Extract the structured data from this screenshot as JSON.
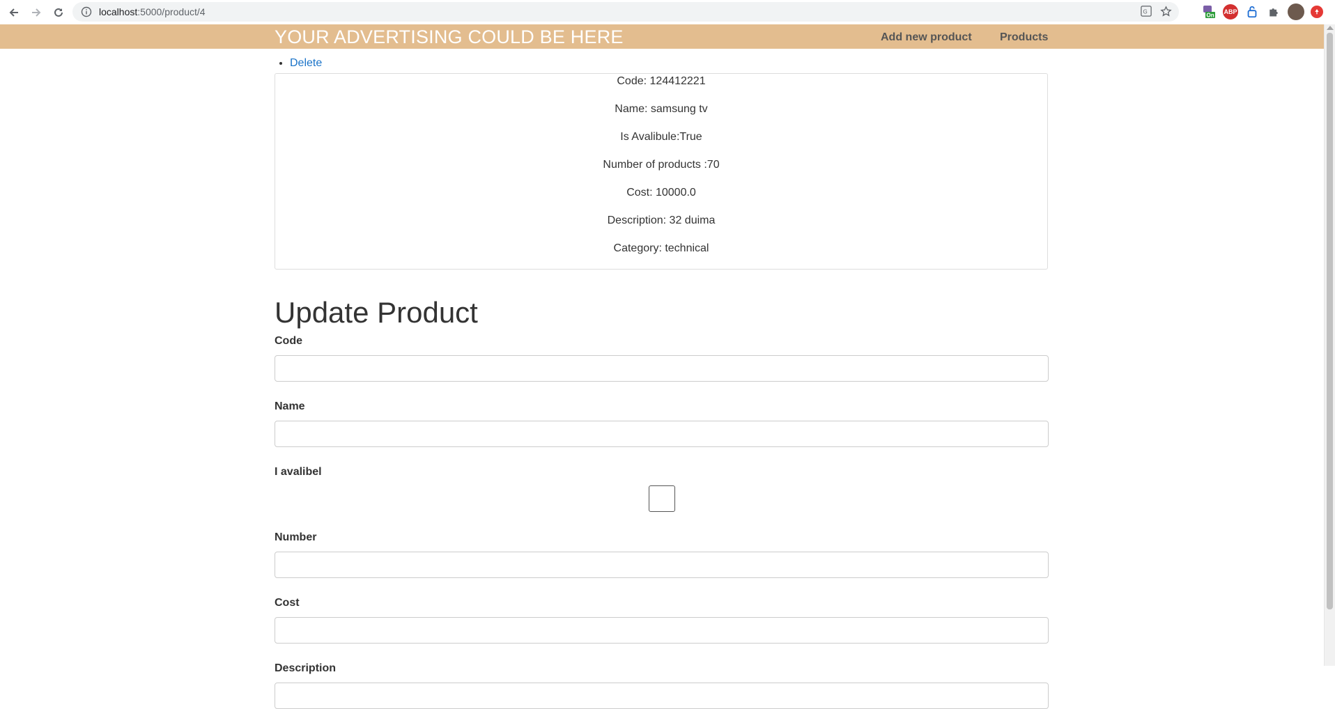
{
  "browser": {
    "url_host": "localhost",
    "url_path": ":5000/product/4"
  },
  "navbar": {
    "brand": "YOUR ADVERTISING COULD BE HERE",
    "links": [
      "Add new product",
      "Products"
    ]
  },
  "actions": {
    "delete_label": "Delete"
  },
  "product": {
    "code": "Code: 124412221",
    "name": "Name: samsung tv",
    "available": "Is Avalibule:True",
    "number": "Number of products :70",
    "cost": "Cost: 10000.0",
    "description": "Description: 32 duima",
    "category": "Category: technical"
  },
  "form": {
    "title": "Update Product",
    "code_label": "Code",
    "name_label": "Name",
    "available_label": "I avalibel",
    "number_label": "Number",
    "cost_label": "Cost",
    "description_label": "Description",
    "available_checked": false
  },
  "extensions": [
    "translate-icon",
    "star-icon",
    "on-extension-icon",
    "abp-icon",
    "lock-extension-icon",
    "puzzle-icon",
    "avatar",
    "red-extension-icon"
  ]
}
